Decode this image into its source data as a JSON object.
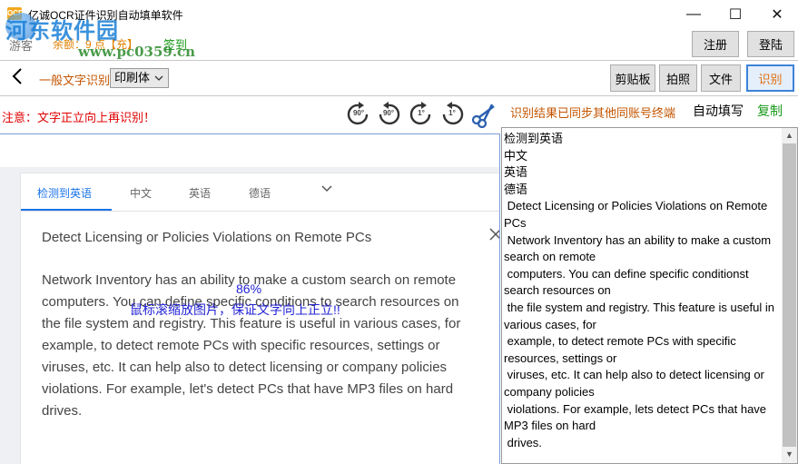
{
  "window": {
    "title": "亿诚OCR证件识别自动填单软件",
    "icon_label": "OCR",
    "controls": {
      "minimize": "—",
      "maximize": "☐",
      "close": "✕"
    }
  },
  "watermark": {
    "site_name": "河东软件园",
    "url": "www.pc0359.cn"
  },
  "account": {
    "user_label": "游客",
    "balance": "余额：9 点【充】",
    "checkin_label": "签到",
    "register_label": "注册",
    "login_label": "登陆"
  },
  "toolbar": {
    "back_icon": "left-arrow",
    "mode_label": "一般文字识别",
    "font_select": {
      "value": "印刷体",
      "caret": "⌵"
    },
    "clipboard_label": "剪贴板",
    "photo_label": "拍照",
    "file_label": "文件",
    "recognize_label": "识别"
  },
  "notice": "注意：文字正立向上再识别！",
  "rotate_buttons": [
    {
      "label": "90°",
      "icon": "rotate-left-90-icon"
    },
    {
      "label": "90°",
      "icon": "rotate-right-90-icon"
    },
    {
      "label": "1°",
      "icon": "rotate-left-1-icon"
    },
    {
      "label": "1°",
      "icon": "rotate-right-1-icon"
    }
  ],
  "crop_icon": "scissors-icon",
  "result_header": {
    "sync_text": "识别结果已同步其他同账号终端",
    "autofill_label": "自动填写",
    "copy_label": "复制"
  },
  "image_preview": {
    "tabs": [
      "检测到英语",
      "中文",
      "英语",
      "德语"
    ],
    "active_tab": 0,
    "more_icon": "chevron-down-icon",
    "close_icon": "close-icon",
    "card_title": "Detect Licensing or Policies Violations on Remote PCs",
    "card_body": "Network Inventory has an ability to make a custom search on remote computers. You can define specific conditions to search resources on the file system and registry. This feature is useful in various cases, for example, to detect remote PCs with specific resources, settings or viruses, etc. It can help also to detect licensing or company policies violations. For example, let's detect PCs that have MP3 files on hard drives.",
    "zoom_percent": "86%",
    "zoom_hint": "鼠标滚缩放图片，保证文字向上正立!!"
  },
  "result_text": "检测到英语\n中文\n英语\n德语\n Detect Licensing or Policies Violations on Remote PCs\n Network Inventory has an ability to make a custom search on remote\n computers. You can define specific conditionst search resources on\n the file system and registry. This feature is useful in various cases, for\n example, to detect remote PCs with specific resources, settings or\n viruses, etc. It can help also to detect licensing or company policies\n violations. For example, lets detect PCs that have MP3 files on hard\n drives.",
  "colors": {
    "accent_blue": "#3c82d8",
    "notice_red": "#e00000",
    "orange_label": "#c45500",
    "green_label": "#1a9a1a",
    "zoom_blue": "#2323d6"
  }
}
